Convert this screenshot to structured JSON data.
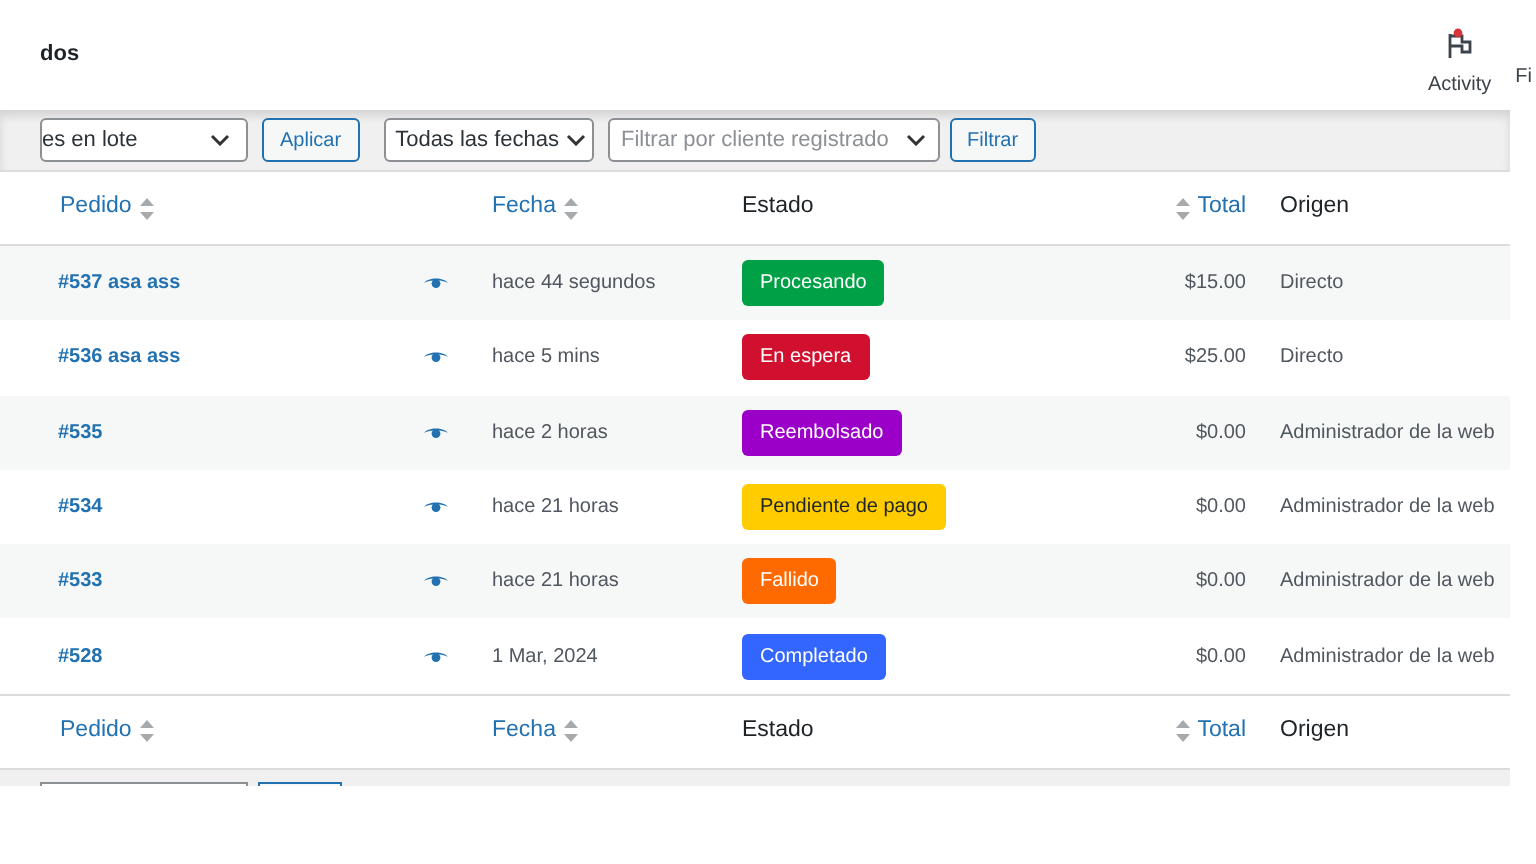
{
  "page_title": "dos",
  "header_actions": [
    {
      "label": "Activity",
      "kind": "activity",
      "notification": true
    },
    {
      "label": "Fi",
      "kind": "text"
    }
  ],
  "toolbar": {
    "bulk_select": "es en lote",
    "apply": "Aplicar",
    "date_select": "Todas las fechas",
    "customer_filter": {
      "placeholder": "Filtrar por cliente registrado"
    },
    "filter": "Filtrar"
  },
  "columns": [
    {
      "label": "Pedido",
      "sortable": true
    },
    {
      "label": "Fecha",
      "sortable": true
    },
    {
      "label": "Estado",
      "sortable": false
    },
    {
      "label": "Total",
      "sortable": true
    },
    {
      "label": "Origen",
      "sortable": false
    }
  ],
  "rows": [
    {
      "order": "#537 asa ass",
      "date": "hace 44 segundos",
      "status": "Procesando",
      "color": "#00a046",
      "total": "$15.00",
      "origin": "Directo"
    },
    {
      "order": "#536 asa ass",
      "date": "hace 5 mins",
      "status": "En espera",
      "color": "#d0102e",
      "total": "$25.00",
      "origin": "Directo"
    },
    {
      "order": "#535",
      "date": "hace 2 horas",
      "status": "Reembolsado",
      "color": "#9b00c8",
      "total": "$0.00",
      "origin": "Administrador de la web"
    },
    {
      "order": "#534",
      "date": "hace 21 horas",
      "status": "Pendiente de pago",
      "color": "#ffcc00",
      "total": "$0.00",
      "origin": "Administrador de la web"
    },
    {
      "order": "#533",
      "date": "hace 21 horas",
      "status": "Fallido",
      "color": "#ff6a00",
      "total": "$0.00",
      "origin": "Administrador de la web"
    },
    {
      "order": "#528",
      "date": "1 Mar, 2024",
      "status": "Completado",
      "color": "#3366ff",
      "total": "$0.00",
      "origin": "Administrador de la web"
    }
  ],
  "footer_columns": [
    {
      "label": "Pedido",
      "sortable": true
    },
    {
      "label": "Fecha",
      "sortable": true
    },
    {
      "label": "Estado",
      "sortable": false
    },
    {
      "label": "Total",
      "sortable": true
    },
    {
      "label": "Origen",
      "sortable": false
    }
  ]
}
